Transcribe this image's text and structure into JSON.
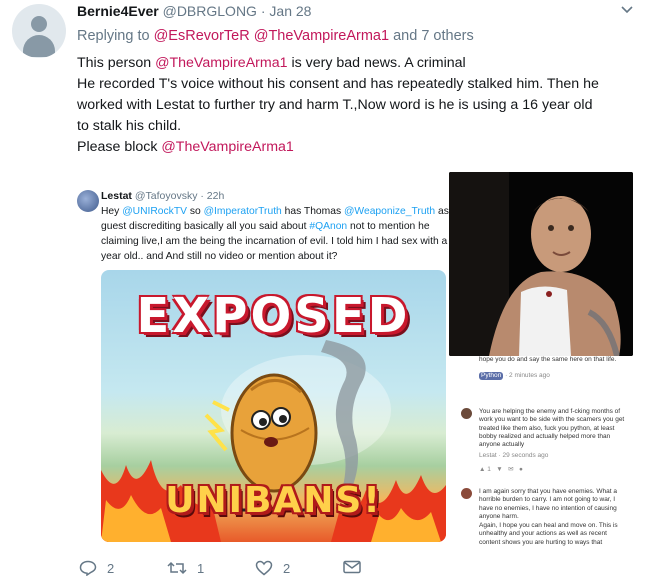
{
  "tweet": {
    "display_name": "Bernie4Ever",
    "handle": "@DBRGLONG",
    "separator": "·",
    "time": "Jan 28",
    "reply_prefix": "Replying to",
    "reply_user1": "@EsRevorTeR",
    "reply_user2": "@TheVampireArma1",
    "reply_suffix": "and 7 others",
    "line1_pre": "This person ",
    "line1_mention": "@TheVampireArma1",
    "line1_post": " is very bad news. A criminal",
    "line2": "He recorded T's voice without his consent and has repeatedly stalked him. Then he",
    "line3": "worked with Lestat to further try and harm T.,Now word is he is using a 16 year old",
    "line4": "to stalk his child.",
    "line5_pre": "Please block ",
    "line5_mention": "@TheVampireArma1"
  },
  "embedded": {
    "name": "Lestat",
    "handle": "@Tafoyovsky",
    "time": "· 22h",
    "l1_a": "Hey ",
    "l1_m1": "@UNIRockTV",
    "l1_b": " so ",
    "l1_m2": "@ImperatorTruth",
    "l1_c": " has Thomas ",
    "l1_m3": "@Weaponize_Truth",
    "l1_d": " as a",
    "l2_a": "guest discrediting basically all you said about ",
    "l2_m": "#QAnon",
    "l2_b": " not to mention he",
    "l3": "claiming live,I am the being the incarnation of evil. I told him I had sex with a",
    "l4": "year old.. and And still no video or mention about it?",
    "banner_top": "EXPOSED",
    "banner_bottom": "UNIBANS!"
  },
  "comments": {
    "c0_text": "hope you do and say the same here on that life.",
    "c0_name": "Python",
    "c0_time": "· 2 minutes ago",
    "c1_text": "You are helping the enemy and f-cking months of work you want to be side with the scamers you get treated like them also, fuck you python, at least bobby realized and actually helped more than anyone actually",
    "c1_meta": "Lestat · 29 seconds ago",
    "c1_likes": "1",
    "c2_text": "I am again sorry that you have enemies. What a horrible burden to carry. I am not going to war, I have no enemies, I have no intention of causing anyone harm.",
    "c2_text2": "Again, I hope you can heal and move on. This is unhealthy and your actions as well as recent content shows you are hurting to ways that"
  },
  "actions": {
    "replies": "2",
    "retweets": "1",
    "likes": "2"
  },
  "colors": {
    "mention": "#c2185b",
    "embedded_link": "#1da1f2",
    "muted": "#657786"
  }
}
